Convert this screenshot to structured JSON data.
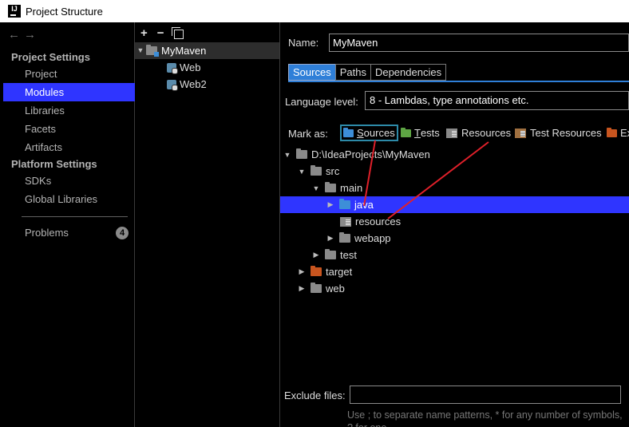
{
  "window": {
    "title": "Project Structure",
    "logo_text": "IJ"
  },
  "nav": {
    "back": "←",
    "forward": "→"
  },
  "sidebar": {
    "project_settings_header": "Project Settings",
    "platform_settings_header": "Platform Settings",
    "items": [
      {
        "label": "Project"
      },
      {
        "label": "Modules"
      },
      {
        "label": "Libraries"
      },
      {
        "label": "Facets"
      },
      {
        "label": "Artifacts"
      },
      {
        "label": "SDKs"
      },
      {
        "label": "Global Libraries"
      },
      {
        "label": "Problems",
        "badge": "4"
      }
    ]
  },
  "modules_toolbar": {
    "add": "+",
    "remove": "−"
  },
  "modules": [
    {
      "label": "MyMaven"
    },
    {
      "label": "Web"
    },
    {
      "label": "Web2"
    }
  ],
  "details": {
    "name_label": "Name:",
    "name_value": "MyMaven",
    "tabs": [
      {
        "label": "Sources"
      },
      {
        "label": "Paths"
      },
      {
        "label": "Dependencies"
      }
    ],
    "language_label": "Language level:",
    "language_value": "8 - Lambdas, type annotations etc.",
    "mark_as_label": "Mark as:",
    "mark_buttons": [
      {
        "label": "Sources",
        "underline": "S",
        "rest": "ources",
        "color": "#3d8ed8"
      },
      {
        "label": "Tests",
        "underline": "T",
        "rest": "ests",
        "color": "#5ea544"
      },
      {
        "label": "Resources"
      },
      {
        "label": "Test Resources"
      },
      {
        "label": "Ex"
      }
    ],
    "tree": [
      {
        "label": "D:\\IdeaProjects\\MyMaven"
      },
      {
        "label": "src"
      },
      {
        "label": "main"
      },
      {
        "label": "java"
      },
      {
        "label": "resources"
      },
      {
        "label": "webapp"
      },
      {
        "label": "test"
      },
      {
        "label": "target"
      },
      {
        "label": "web"
      }
    ],
    "exclude_label": "Exclude files:",
    "exclude_value": "",
    "hint": "Use ; to separate name patterns, * for any number of symbols, ? for one."
  },
  "colors": {
    "selection": "#2f35ff",
    "tab_active": "#2f7fd8",
    "annotation": "#e0202a"
  }
}
